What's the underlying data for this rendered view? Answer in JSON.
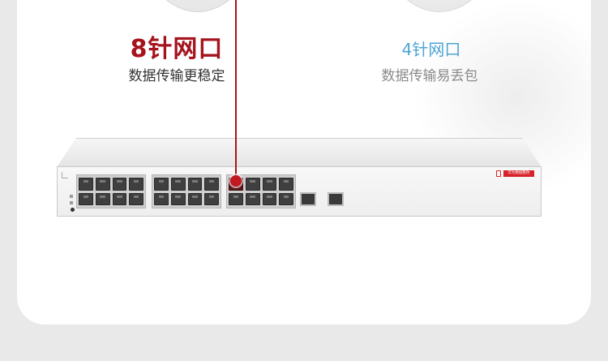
{
  "left_feature": {
    "title": "8针网口",
    "subtitle": "数据传输更稳定",
    "title_color": "#a5131d"
  },
  "right_feature": {
    "title": "4针网口",
    "subtitle": "数据传输易丢包",
    "title_color": "#4ea4d3"
  },
  "device": {
    "brand_label": "华为数据整改"
  },
  "colors": {
    "accent_red": "#c21820",
    "background": "#e9e9e9",
    "card": "#ffffff"
  }
}
